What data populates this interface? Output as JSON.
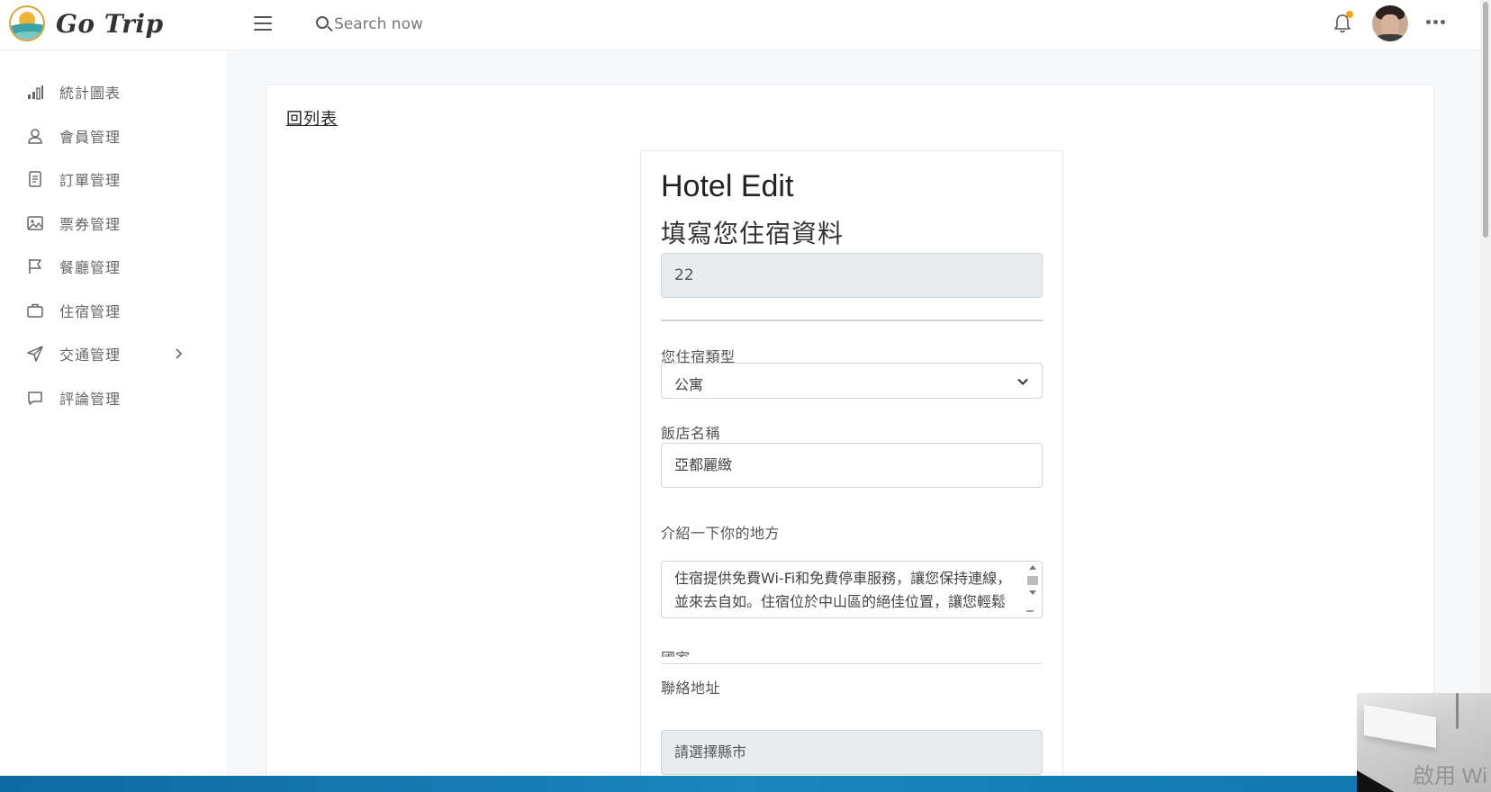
{
  "app": {
    "name": "Go Trip"
  },
  "header": {
    "search_placeholder": "Search now"
  },
  "sidebar": {
    "items": [
      {
        "label": "統計圖表",
        "icon": "bar-chart-icon"
      },
      {
        "label": "會員管理",
        "icon": "user-icon"
      },
      {
        "label": "訂單管理",
        "icon": "document-icon"
      },
      {
        "label": "票券管理",
        "icon": "image-icon"
      },
      {
        "label": "餐廳管理",
        "icon": "flag-icon"
      },
      {
        "label": "住宿管理",
        "icon": "briefcase-icon"
      },
      {
        "label": "交通管理",
        "icon": "send-icon",
        "has_submenu": true
      },
      {
        "label": "評論管理",
        "icon": "message-icon"
      }
    ]
  },
  "main": {
    "back_link": "回列表",
    "form": {
      "title": "Hotel Edit",
      "subtitle": "填寫您住宿資料",
      "id_value": "22",
      "type_label": "您住宿類型",
      "type_value": "公寓",
      "name_label": "飯店名稱",
      "name_value": "亞都麗緻",
      "intro_label": "介紹一下你的地方",
      "intro_value": "住宿提供免費Wi-Fi和免費停車服務，讓您保持連線，並來去自如。住宿位於中山區的絕佳位置，讓您輕鬆探索鄰近的景點。",
      "country_label": "國家",
      "address_label": "聯絡地址",
      "city_placeholder": "請選擇縣市"
    }
  },
  "overlay": {
    "watermark": "啟用 Wi"
  },
  "colors": {
    "accent": "#f2a516",
    "taskbar": "#1b85bd",
    "readonly_bg": "#e9ecef"
  }
}
